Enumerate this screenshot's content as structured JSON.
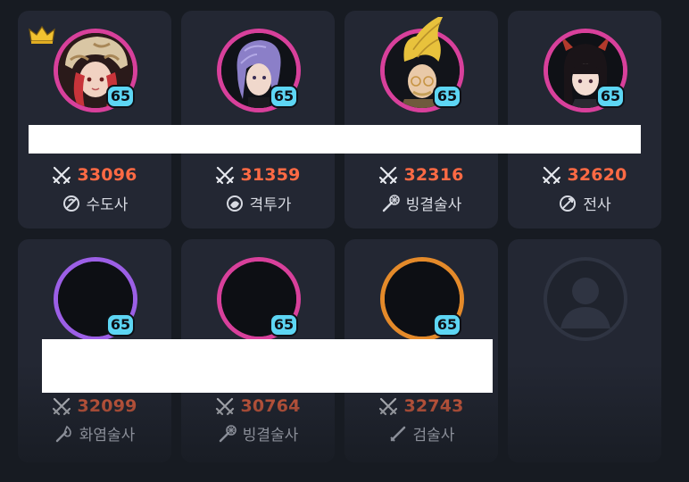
{
  "members": [
    {
      "level": "65",
      "power": "33096",
      "class_name": "수도사",
      "class_icon": "monk-class-icon",
      "ring": "#d8409b",
      "portrait": "hat-red-hair",
      "leader": true
    },
    {
      "level": "65",
      "power": "31359",
      "class_name": "격투가",
      "class_icon": "fighter-class-icon",
      "ring": "#d8409b",
      "portrait": "purple-hair"
    },
    {
      "level": "65",
      "power": "32316",
      "class_name": "빙결술사",
      "class_icon": "ice-mage-class-icon",
      "ring": "#d8409b",
      "portrait": "blonde-glasses"
    },
    {
      "level": "65",
      "power": "32620",
      "class_name": "전사",
      "class_icon": "warrior-class-icon",
      "ring": "#d8409b",
      "portrait": "dark-hair-horns"
    },
    {
      "level": "65",
      "power": "32099",
      "class_name": "화염술사",
      "class_icon": "fire-mage-class-icon",
      "ring": "#9c5fe6",
      "portrait": "empty-dark"
    },
    {
      "level": "65",
      "power": "30764",
      "class_name": "빙결술사",
      "class_icon": "ice-mage-class-icon",
      "ring": "#d8409b",
      "portrait": "empty-dark"
    },
    {
      "level": "65",
      "power": "32743",
      "class_name": "검술사",
      "class_icon": "swordsman-class-icon",
      "ring": "#e48a2a",
      "portrait": "empty-dark"
    }
  ],
  "empty_slot": {
    "icon": "user-placeholder-icon"
  },
  "icons": {
    "power": "crossed-swords-icon",
    "leader": "crown-icon"
  },
  "colors": {
    "background": "#171b22",
    "card": "#232733",
    "power_text": "#ff6a44",
    "level_badge": "#5dd6f4"
  }
}
